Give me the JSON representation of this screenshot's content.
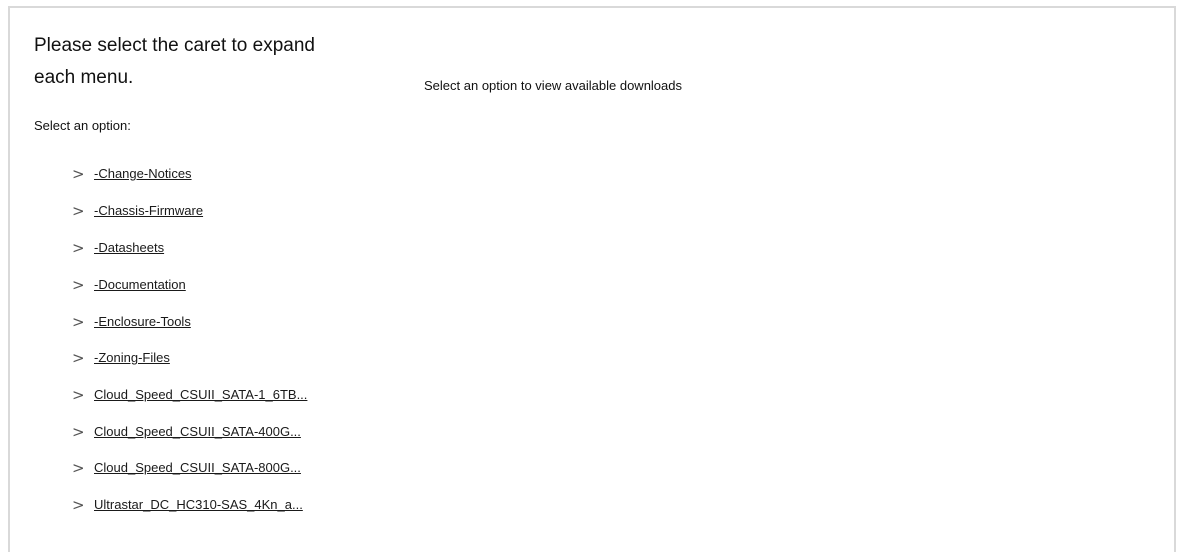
{
  "heading": "Please select the caret to expand each menu.",
  "select_label": "Select an option:",
  "right_message": "Select an option to view available downloads",
  "tree": {
    "caret_glyph": ">",
    "items": [
      {
        "label": "-Change-Notices"
      },
      {
        "label": "-Chassis-Firmware"
      },
      {
        "label": "-Datasheets"
      },
      {
        "label": "-Documentation"
      },
      {
        "label": "-Enclosure-Tools"
      },
      {
        "label": "-Zoning-Files"
      },
      {
        "label": "Cloud_Speed_CSUII_SATA-1_6TB..."
      },
      {
        "label": "Cloud_Speed_CSUII_SATA-400G..."
      },
      {
        "label": "Cloud_Speed_CSUII_SATA-800G..."
      },
      {
        "label": "Ultrastar_DC_HC310-SAS_4Kn_a..."
      }
    ]
  },
  "scrollbar": {
    "up_arrow": "▲",
    "down_arrow": "▼"
  },
  "colors": {
    "frame_border": "#d9d9d9",
    "scrollbar_track": "#f1f1f1",
    "scrollbar_thumb": "#c1c1c1",
    "text": "#1a1a1a"
  }
}
